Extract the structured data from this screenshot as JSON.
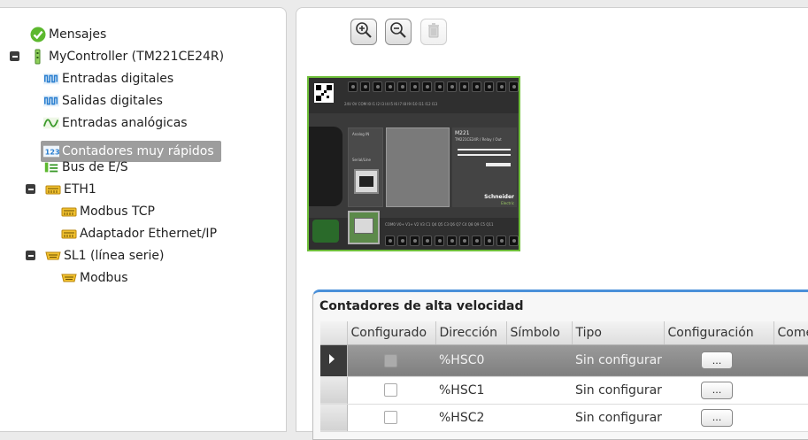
{
  "tree": {
    "items": [
      {
        "label": "Mensajes"
      },
      {
        "label": "MyController  (TM221CE24R)"
      },
      {
        "label": "Entradas digitales"
      },
      {
        "label": "Salidas digitales"
      },
      {
        "label": "Entradas analógicas"
      },
      {
        "label": "Contadores muy rápidos"
      },
      {
        "label": "Bus de E/S"
      },
      {
        "label": "ETH1"
      },
      {
        "label": "Modbus TCP"
      },
      {
        "label": "Adaptador Ethernet/IP"
      },
      {
        "label": "SL1 (línea serie)"
      },
      {
        "label": "Modbus"
      }
    ]
  },
  "toolbar": {
    "zoom_in": "zoom-in-icon",
    "zoom_out": "zoom-out-icon",
    "delete": "trash-icon"
  },
  "plc": {
    "model": "M221",
    "ref": "TM221CE24R / Relay / Out",
    "brand": "Schneider",
    "brand_sub": "Electric",
    "top_labels": "24V  0V  COM  I0   I1   I2   I3   I4   I5   I6   I7   I8   I9   I10  I11  I12  I13",
    "bottom_labels": "COM0 V0+  V1+  V2  V3  C1  Q4  Q5  C3  Q6  Q7  C4  Q8  Q9  C5  Q11",
    "panel_label_1": "Analog IN",
    "panel_label_2": "Serial/Line"
  },
  "hsc": {
    "title": "Contadores de alta velocidad",
    "columns": [
      "Configurado",
      "Dirección",
      "Símbolo",
      "Tipo",
      "Configuración",
      "Come"
    ],
    "rows": [
      {
        "address": "%HSC0",
        "symbol": "",
        "type": "Sin configurar",
        "config_btn": "...",
        "active": true
      },
      {
        "address": "%HSC1",
        "symbol": "",
        "type": "Sin configurar",
        "config_btn": "...",
        "active": false
      },
      {
        "address": "%HSC2",
        "symbol": "",
        "type": "Sin configurar",
        "config_btn": "...",
        "active": false
      }
    ]
  },
  "colors": {
    "accent": "#4a90d9",
    "selection": "#9d9d9d",
    "plc_border": "#6fbf3a"
  }
}
